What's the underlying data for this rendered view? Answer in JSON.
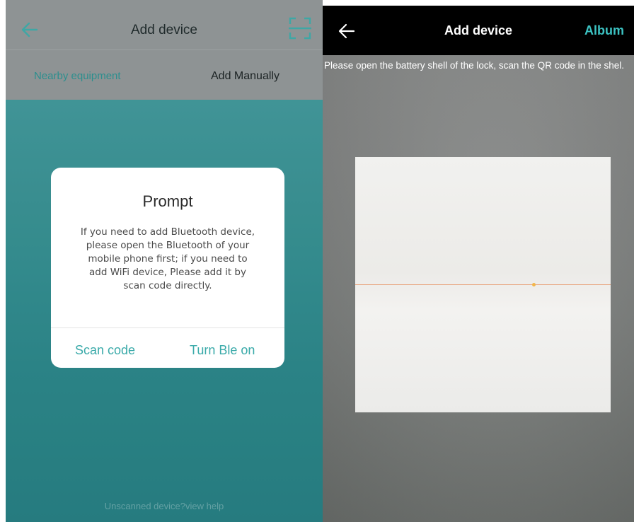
{
  "left_screen": {
    "header": {
      "title": "Add device",
      "back_icon": "arrow-left-icon",
      "scan_icon": "qr-scan-icon"
    },
    "tabs": [
      {
        "label": "Nearby equipment",
        "active": true
      },
      {
        "label": "Add Manually",
        "active": false
      }
    ],
    "dialog": {
      "title": "Prompt",
      "message": "If you need to add Bluetooth device, please open the Bluetooth of your mobile phone first; if you need to add WiFi device, Please add it by scan code directly.",
      "buttons": {
        "scan_code": "Scan code",
        "turn_ble_on": "Turn Ble on"
      }
    },
    "footer_link": "Unscanned device?view help",
    "colors": {
      "accent": "#3aaaa9",
      "background": "#3d9a9c"
    }
  },
  "right_screen": {
    "header": {
      "title": "Add device",
      "album": "Album",
      "back_icon": "arrow-left-icon"
    },
    "instructions": "Please open the battery shell of the lock, scan the QR code in the shel.",
    "colors": {
      "album": "#3cc3c3",
      "scan_line": "#e8a37b"
    }
  }
}
